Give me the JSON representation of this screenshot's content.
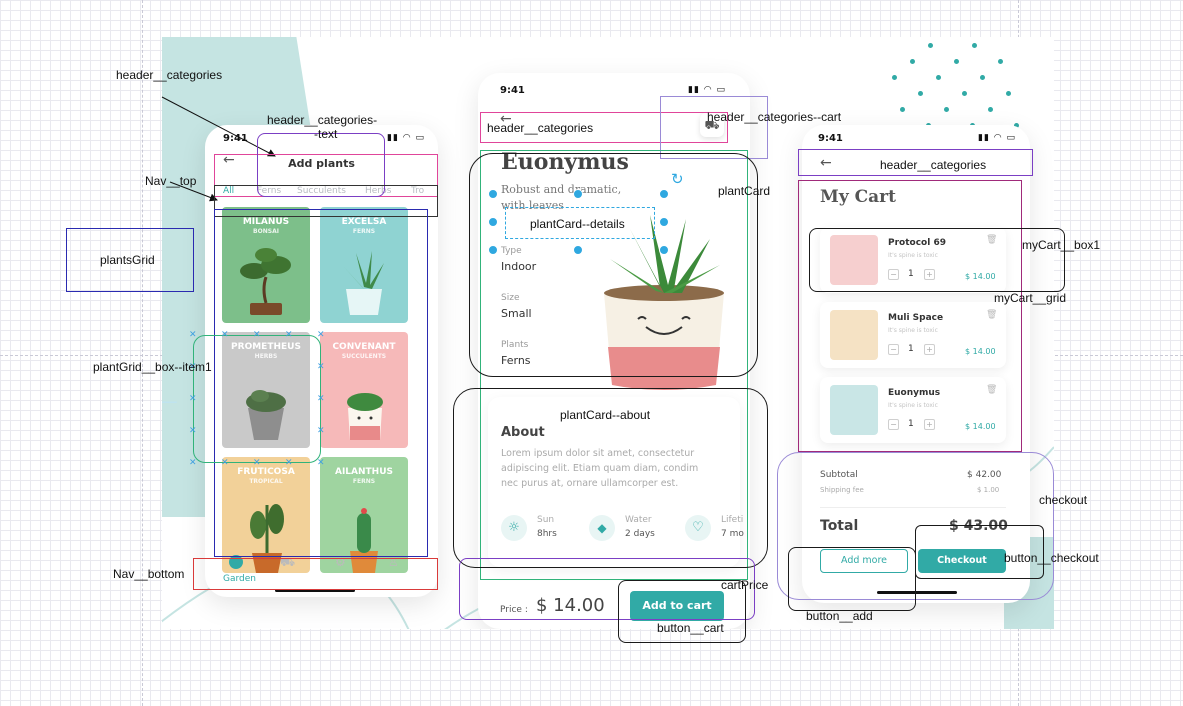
{
  "colors": {
    "accent": "#31aaa6",
    "mint": "#c5e4e2",
    "ann_pink": "#e0459a",
    "ann_purple": "#7b3fc4",
    "ann_blue": "#2a2ab0",
    "ann_black": "#1a1a1a",
    "ann_green": "#31b37a",
    "ann_red": "#d93a3a",
    "handle_blue": "#2fa8e0"
  },
  "status": {
    "time": "9:41",
    "icons": "signal wifi battery"
  },
  "icons": {
    "back": "arrow-left-icon",
    "cart": "cart-icon",
    "delete": "trash-icon",
    "sun": "sun-icon",
    "water": "droplet-icon",
    "heart": "heart-icon",
    "rotate": "rotate-icon",
    "home": "leaf-icon",
    "settings": "gear-icon",
    "profile": "user-icon"
  },
  "phone1": {
    "title": "Add plants",
    "filters": [
      "All",
      "Ferns",
      "Succulents",
      "Herbs",
      "Tro"
    ],
    "plants": [
      {
        "name": "MILANUS",
        "category": "BONSAI",
        "bg": "#7dbf8a"
      },
      {
        "name": "EXCELSA",
        "category": "FERNS",
        "bg": "#8fd3d2"
      },
      {
        "name": "PROMETHEUS",
        "category": "HERBS",
        "bg": "#c9c9c9"
      },
      {
        "name": "CONVENANT",
        "category": "SUCCULENTS",
        "bg": "#f6b9b9"
      },
      {
        "name": "FRUTICOSA",
        "category": "TROPICAL",
        "bg": "#f2d199"
      },
      {
        "name": "AILANTHUS",
        "category": "FERNS",
        "bg": "#9fd4a0"
      }
    ],
    "nav_active_label": "Garden"
  },
  "phone2": {
    "title": "Euonymus",
    "subtitle_1": "Robust and dramatic,",
    "subtitle_2": "with leaves",
    "specs": [
      {
        "label": "Type",
        "value": "Indoor"
      },
      {
        "label": "Size",
        "value": "Small"
      },
      {
        "label": "Plants",
        "value": "Ferns"
      }
    ],
    "about_title": "About",
    "about_line_1": "Lorem ipsum dolor sit amet, consectetur",
    "about_line_2": "adipiscing elit. Etiam quam diam, condim",
    "about_line_3": "nec purus at, ornare ullamcorper est.",
    "care": [
      {
        "label": "Sun",
        "value": "8hrs"
      },
      {
        "label": "Water",
        "value": "2 days"
      },
      {
        "label": "Lifeti",
        "value": "7 mo"
      }
    ],
    "price_label": "Price :",
    "price_value": "$ 14.00",
    "add_to_cart": "Add to cart"
  },
  "phone3": {
    "title": "My Cart",
    "items": [
      {
        "name": "Protocol 69",
        "sub": "It's spine is toxic",
        "qty": "1",
        "price": "$ 14.00",
        "bg": "#f6cfcf"
      },
      {
        "name": "Muli Space",
        "sub": "It's spine is toxic",
        "qty": "1",
        "price": "$ 14.00",
        "bg": "#f5e2c4"
      },
      {
        "name": "Euonymus",
        "sub": "It's spine is toxic",
        "qty": "1",
        "price": "$ 14.00",
        "bg": "#c9e6e6"
      }
    ],
    "subtotal_label": "Subtotal",
    "subtotal_value": "$ 42.00",
    "shipping_label": "Shipping fee",
    "shipping_value": "$ 1.00",
    "total_label": "Total",
    "total_value": "$ 43.00",
    "add_more": "Add more",
    "checkout": "Checkout"
  },
  "annotations": {
    "header_categories": "header__categories",
    "header_categories_text_1": "header__categories-",
    "header_categories_text_2": "-text",
    "nav_top": "Nav__top",
    "plants_grid": "plantsGrid",
    "plant_grid_box_item": "plantGrid__box--item1",
    "nav_bottom": "Nav__bottom",
    "header_categories_cart": "header__categories--cart",
    "plant_card": "plantCard",
    "plant_card_details": "plantCard--details",
    "plant_card_about": "plantCard--about",
    "cart_price": "cartPrice",
    "button_cart": "button__cart",
    "my_cart_box1": "myCart__box1",
    "my_cart_grid": "myCart__grid",
    "checkout": "checkout",
    "button_checkout": "button__checkout",
    "button_add": "button__add"
  }
}
